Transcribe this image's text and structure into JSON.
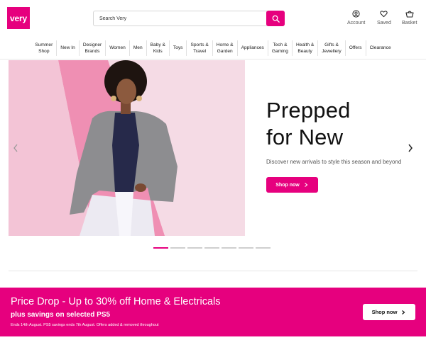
{
  "header": {
    "logo_text": "very",
    "search_placeholder": "Search Very",
    "account_label": "Account",
    "saved_label": "Saved",
    "basket_label": "Basket",
    "brand_color": "#e6007e"
  },
  "nav": {
    "items": [
      {
        "line1": "Summer",
        "line2": "Shop"
      },
      {
        "line1": "New In",
        "line2": ""
      },
      {
        "line1": "Designer",
        "line2": "Brands"
      },
      {
        "line1": "Women",
        "line2": ""
      },
      {
        "line1": "Men",
        "line2": ""
      },
      {
        "line1": "Baby &",
        "line2": "Kids"
      },
      {
        "line1": "Toys",
        "line2": ""
      },
      {
        "line1": "Sports &",
        "line2": "Travel"
      },
      {
        "line1": "Home &",
        "line2": "Garden"
      },
      {
        "line1": "Appliances",
        "line2": ""
      },
      {
        "line1": "Tech &",
        "line2": "Gaming"
      },
      {
        "line1": "Health &",
        "line2": "Beauty"
      },
      {
        "line1": "Gifts &",
        "line2": "Jewellery"
      },
      {
        "line1": "Offers",
        "line2": ""
      },
      {
        "line1": "Clearance",
        "line2": ""
      }
    ]
  },
  "hero": {
    "title_line1": "Prepped",
    "title_line2": "for New",
    "subtitle": "Discover new arrivals to style this season and beyond",
    "cta_label": "Shop now",
    "slides_total": 7,
    "active_slide": 1
  },
  "promo": {
    "title": "Price Drop - Up to 30% off Home & Electricals",
    "subtitle": "plus savings on selected PS5",
    "small_print": "Ends 14th August. PS5 savings ends 7th August. Offers added & removed throughout",
    "cta_label": "Shop now"
  },
  "icons": {
    "search": "search-icon",
    "account": "account-icon",
    "saved": "heart-icon",
    "basket": "basket-icon",
    "prev": "chevron-left-icon",
    "next": "chevron-right-icon"
  }
}
